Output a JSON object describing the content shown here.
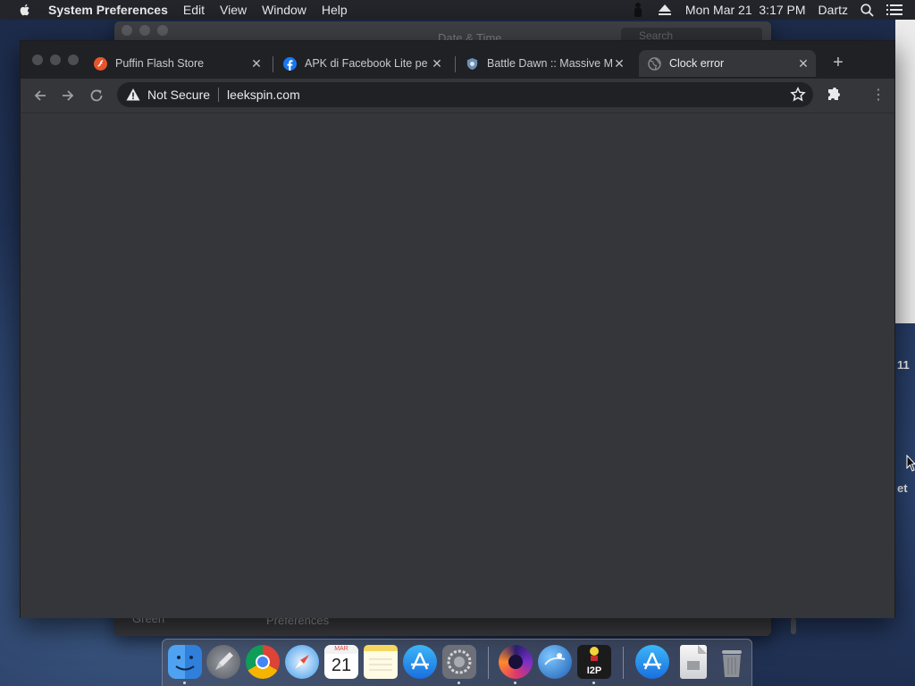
{
  "menubar": {
    "app_name": "System Preferences",
    "menus": [
      "Edit",
      "View",
      "Window",
      "Help"
    ],
    "datetime": "Mon Mar 21  3:17 PM",
    "user": "Dartz"
  },
  "bg_window": {
    "title": "Date & Time",
    "search_placeholder": "Search",
    "footer_text": "Preferences",
    "footer_left": "Green"
  },
  "side_texts": [
    "11",
    "et"
  ],
  "browser": {
    "tabs": [
      {
        "title": "Puffin Flash Store",
        "favicon": "flash-icon"
      },
      {
        "title": "APK di Facebook Lite pe",
        "favicon": "facebook-icon"
      },
      {
        "title": "Battle Dawn :: Massive M",
        "favicon": "shield-icon"
      },
      {
        "title": "Clock error",
        "favicon": "globe-icon",
        "active": true
      }
    ],
    "security_label": "Not Secure",
    "url": "leekspin.com"
  },
  "dock": {
    "apps": [
      "Finder",
      "Launchpad",
      "Google Chrome",
      "Safari",
      "Calendar",
      "Notes",
      "App Store",
      "System Preferences",
      "Firefox Nightly",
      "Network Radar",
      "I2P",
      "App Store Downloads",
      "Document",
      "Trash"
    ],
    "calendar_month": "MAR",
    "calendar_day": "21",
    "i2p_label": "I2P"
  },
  "colors": {
    "menubar": "#23252b",
    "tabstrip": "#202124",
    "toolbar": "#35363a",
    "omnibox": "#202124"
  }
}
